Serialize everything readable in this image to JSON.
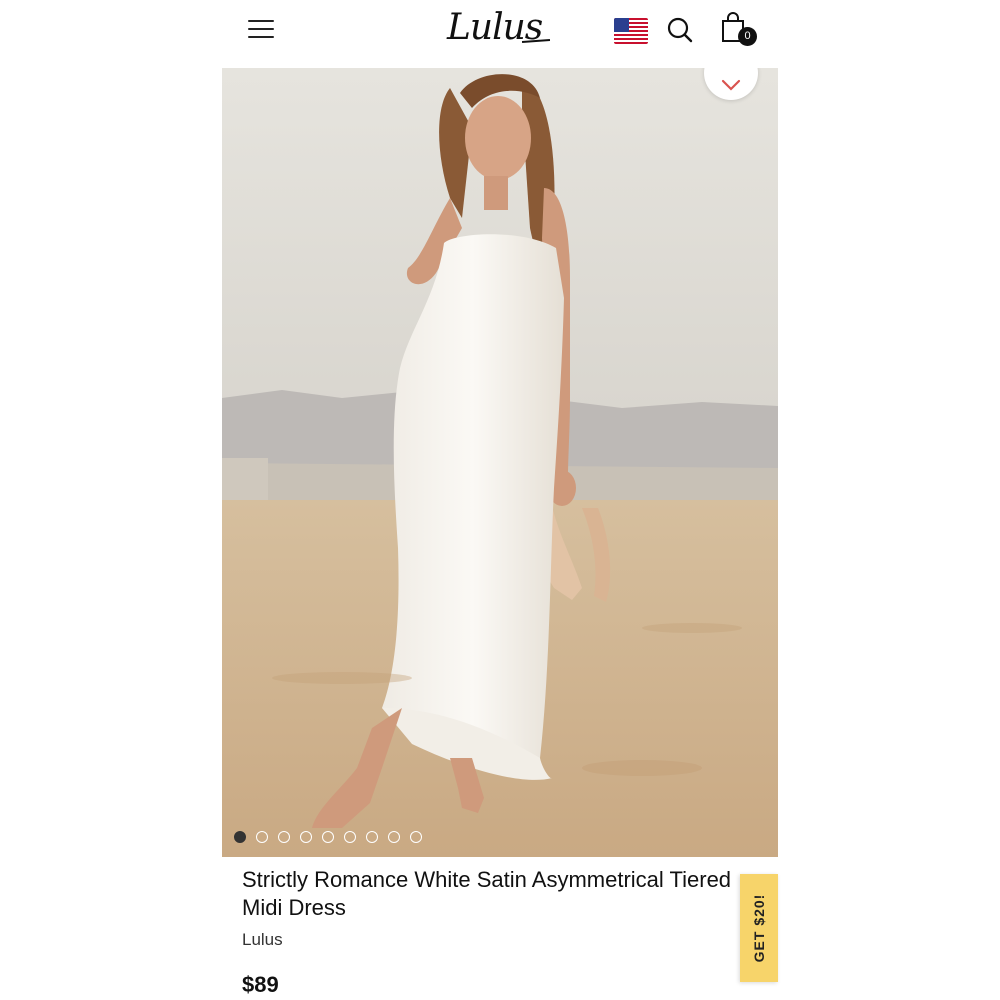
{
  "header": {
    "logo_text": "Lulus",
    "cart_count": "0",
    "icons": {
      "menu": "hamburger-menu-icon",
      "flag": "us-flag-icon",
      "search": "search-icon",
      "bag": "shopping-bag-icon"
    }
  },
  "gallery": {
    "image_count": 9,
    "active_index": 0,
    "favorite_icon": "heart-icon"
  },
  "product": {
    "title": "Strictly Romance White Satin Asymmetrical Tiered Midi Dress",
    "brand": "Lulus",
    "price": "$89"
  },
  "promo": {
    "label": "GET $20!"
  },
  "colors": {
    "accent_promo": "#f7d46a",
    "heart": "#d9534f",
    "text": "#111111"
  }
}
